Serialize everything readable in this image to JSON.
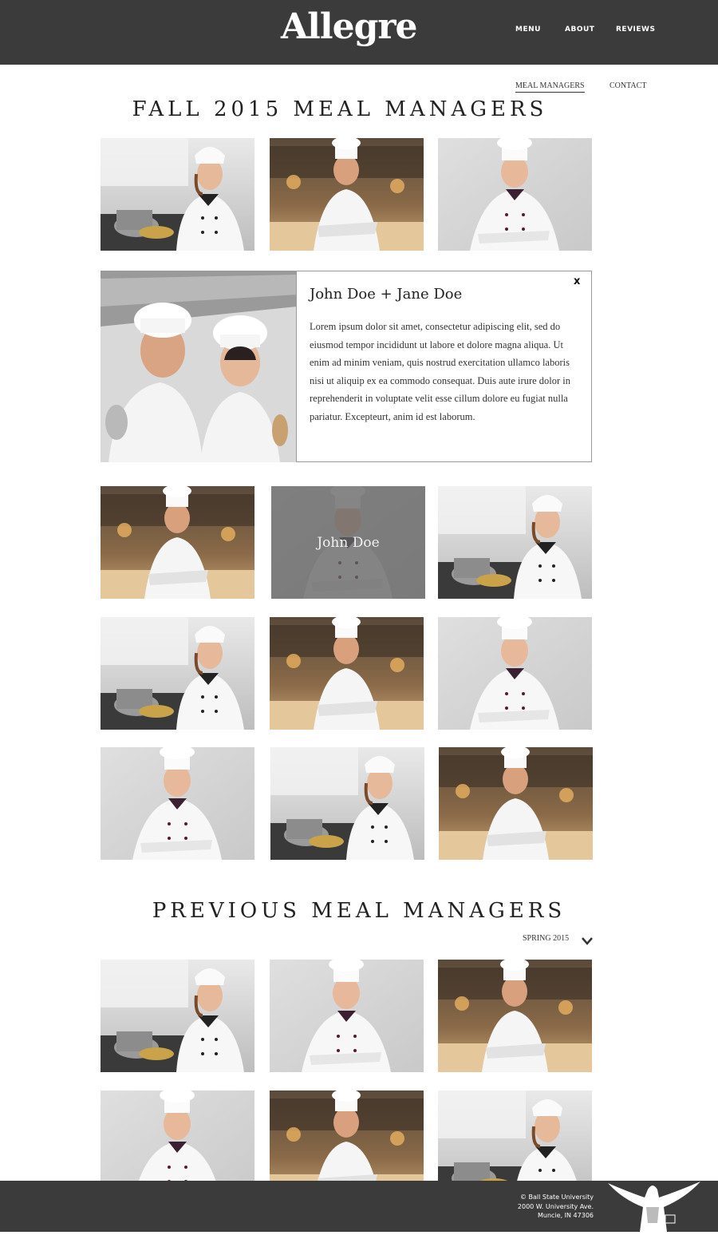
{
  "header": {
    "logo": "Allegre",
    "nav": [
      "MENU",
      "ABOUT",
      "REVIEWS"
    ]
  },
  "subnav": {
    "meal_managers": "MEAL MANAGERS",
    "contact": "CONTACT"
  },
  "current": {
    "title": "FALL 2015 MEAL MANAGERS"
  },
  "expanded": {
    "name": "John Doe + Jane Doe",
    "bio": "Lorem ipsum dolor sit amet, consectetur adipiscing elit, sed do eiusmod tempor incididunt ut labore et dolore magna aliqua. Ut enim ad minim veniam, quis nostrud exercitation ullamco laboris nisi ut aliquip ex ea commodo consequat. Duis aute irure dolor in reprehenderit in voluptate velit esse cillum dolore eu fugiat nulla pariatur. Excepteurt, anim id est laborum.",
    "close": "x"
  },
  "hover_tile": {
    "name": "John Doe"
  },
  "previous": {
    "title": "PREVIOUS MEAL MANAGERS",
    "semester": "SPRING 2015"
  },
  "footer": {
    "line1": "© Ball State University",
    "line2": "2000 W. University Ave.",
    "line3": "Muncie, IN 47306"
  },
  "colors": {
    "header_bg": "#3b3b3b",
    "footer_bg": "#3b3b3b",
    "overlay": "#646464"
  },
  "icons": {
    "dropdown": "chevron-down-icon",
    "mascot": "cardinal-statue-icon"
  }
}
